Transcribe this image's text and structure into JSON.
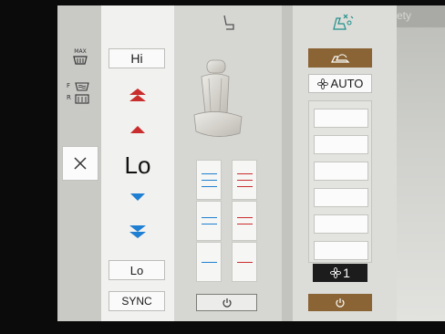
{
  "left": {
    "max_defrost_label": "MAX",
    "front_label": "F",
    "rear_label": "R"
  },
  "temperature": {
    "hi_label": "Hi",
    "current": "Lo",
    "lo_label": "Lo",
    "sync_label": "SYNC"
  },
  "fan": {
    "auto_label": "AUTO",
    "level": "1",
    "accent": "#8a6435"
  },
  "background": {
    "partial_text": "ety"
  },
  "colors": {
    "heat": "#c92d2d",
    "cool": "#1f7fd2"
  }
}
